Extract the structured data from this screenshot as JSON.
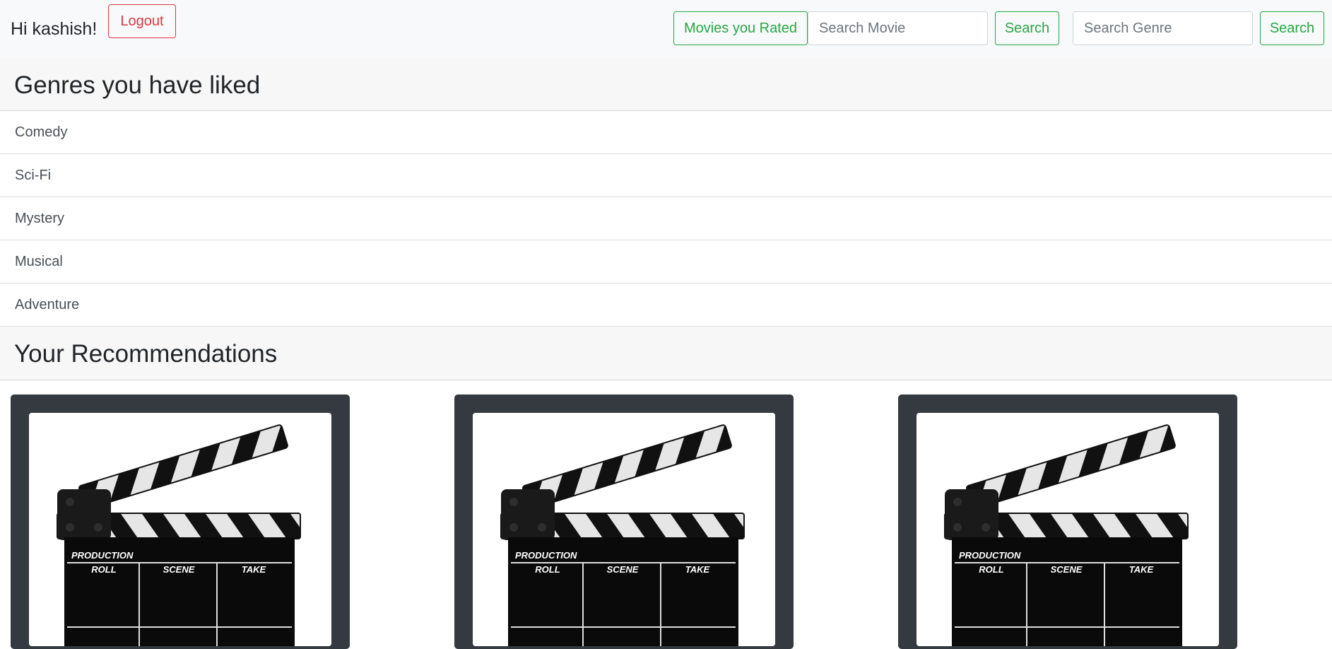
{
  "navbar": {
    "greeting": "Hi kashish!",
    "logout_label": "Logout",
    "rated_label": "Movies you Rated",
    "movie_search_placeholder": "Search Movie",
    "movie_search_label": "Search",
    "genre_search_placeholder": "Search Genre",
    "genre_search_label": "Search"
  },
  "genres_section": {
    "title": "Genres you have liked",
    "items": [
      "Comedy",
      "Sci-Fi",
      "Mystery",
      "Musical",
      "Adventure"
    ]
  },
  "recommendations_section": {
    "title": "Your Recommendations",
    "cards": [
      {
        "image": "clapperboard-icon",
        "board_text": {
          "production": "PRODUCTION",
          "roll": "ROLL",
          "scene": "SCENE",
          "take": "TAKE"
        }
      },
      {
        "image": "clapperboard-icon",
        "board_text": {
          "production": "PRODUCTION",
          "roll": "ROLL",
          "scene": "SCENE",
          "take": "TAKE"
        }
      },
      {
        "image": "clapperboard-icon",
        "board_text": {
          "production": "PRODUCTION",
          "roll": "ROLL",
          "scene": "SCENE",
          "take": "TAKE"
        }
      }
    ]
  },
  "colors": {
    "navbar_bg": "#f8f9fa",
    "danger": "#dc3545",
    "success": "#28a745",
    "card_bg": "#343a40",
    "section_bg": "#f7f7f7"
  }
}
